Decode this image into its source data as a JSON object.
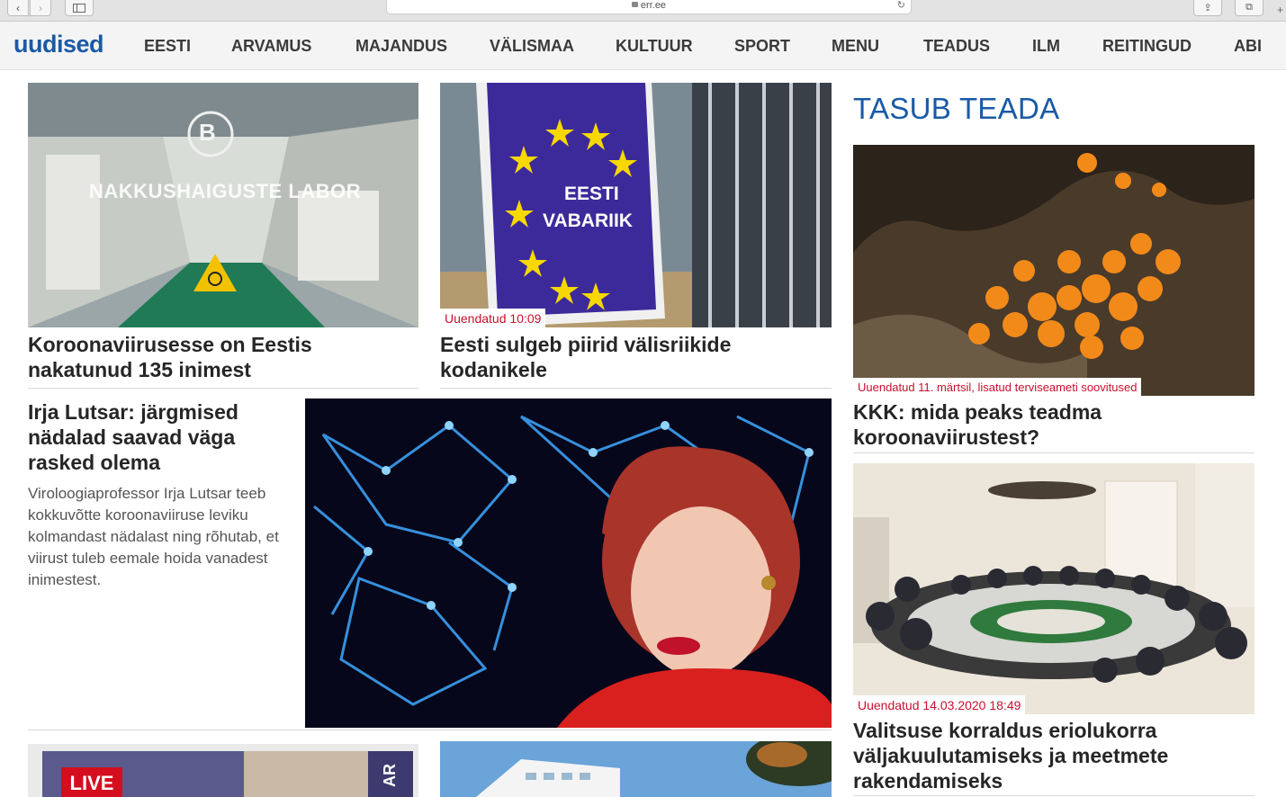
{
  "browser": {
    "url": "err.ee",
    "back_icon": "‹",
    "forward_icon": "›",
    "reload_icon": "↻",
    "share_icon": "⇪",
    "tabs_icon": "⧉",
    "plus_icon": "+"
  },
  "header": {
    "logo": "uudised",
    "menu": [
      "EESTI",
      "ARVAMUS",
      "MAJANDUS",
      "VÄLISMAA",
      "KULTUUR",
      "SPORT",
      "MENU",
      "TEADUS",
      "ILM",
      "REITINGUD",
      "ABI"
    ]
  },
  "articles": {
    "lab": {
      "headline": "Koroonaviirusesse on Eestis nakatunud 135 inimest",
      "image_caption": "NAKKUSHAIGUSTE LABOR",
      "logo_letter": "B"
    },
    "border": {
      "stamp": "Uuendatud 10:09",
      "headline": "Eesti sulgeb piirid välisriikide kodanikele",
      "sign_line1": "EESTI",
      "sign_line2": "VABARIIK"
    },
    "lutsar": {
      "headline": "Irja Lutsar: järgmised nädalad saavad väga rasked olema",
      "lede": "Viroloogiaprofessor Irja Lutsar teeb kokkuvõtte koroonaviiruse leviku kolmandast nädalast ning rõhutab, et viirust tuleb eemale hoida vanadest inimestest."
    },
    "live": {
      "badge": "LIVE",
      "side_text": "AR"
    }
  },
  "sidebar": {
    "title": "TASUB TEADA",
    "items": [
      {
        "stamp": "Uuendatud 11. märtsil, lisatud terviseameti soovitused",
        "headline": "KKK: mida peaks teadma koroonaviirustest?"
      },
      {
        "stamp": "Uuendatud 14.03.2020 18:49",
        "headline": "Valitsuse korraldus eriolukorra väljakuulutamiseks ja meetmete rakendamiseks"
      }
    ]
  },
  "colors": {
    "brand": "#1a5aa6",
    "stamp": "#c8102e"
  }
}
